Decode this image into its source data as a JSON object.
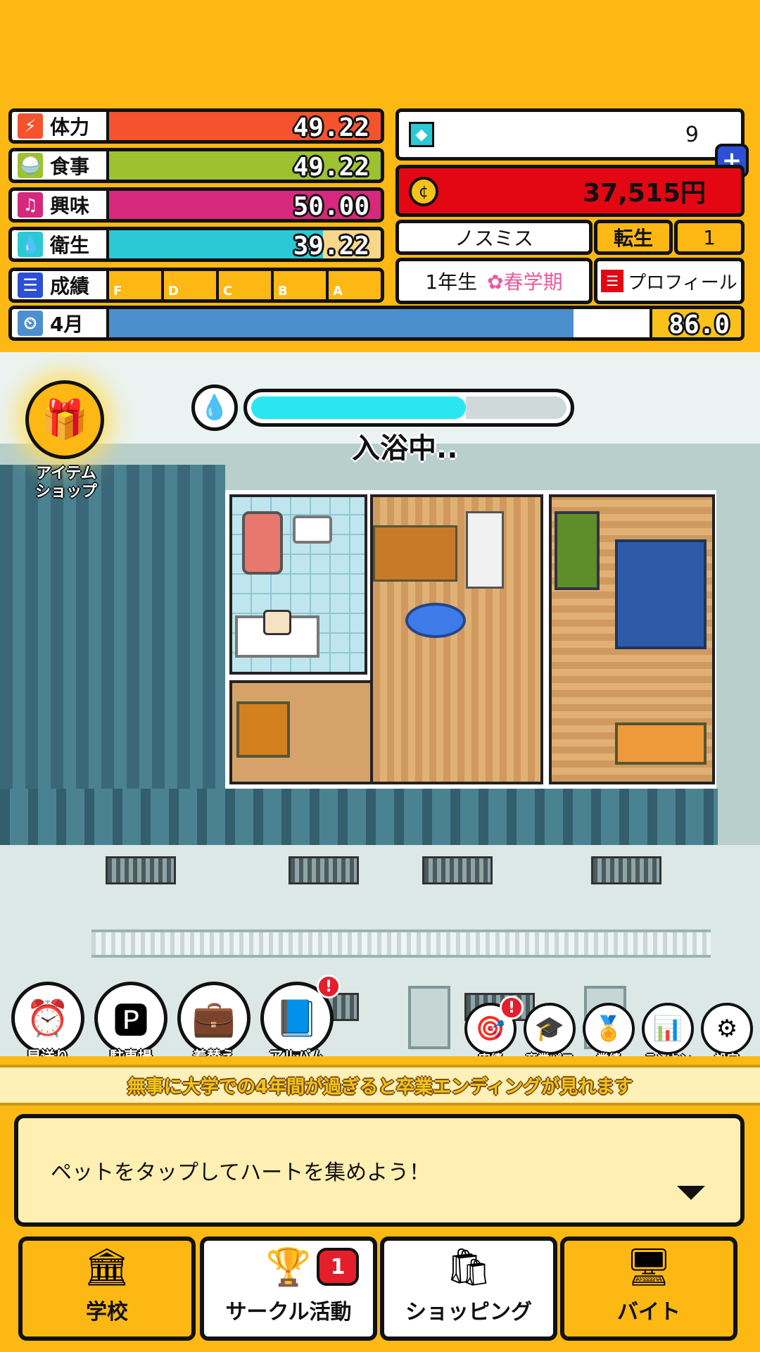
{
  "stats": [
    {
      "label": "体力",
      "value": "49.22",
      "color": "#F4532E",
      "icon": "lightning-icon",
      "fraction": 1.0
    },
    {
      "label": "食事",
      "value": "49.22",
      "color": "#9CC230",
      "icon": "food-icon",
      "fraction": 1.0
    },
    {
      "label": "興味",
      "value": "50.00",
      "color": "#D6287C",
      "icon": "music-note-icon",
      "fraction": 1.0
    },
    {
      "label": "衛生",
      "value": "39.22",
      "color": "#2BC9D6",
      "icon": "droplet-icon",
      "fraction": 0.79
    }
  ],
  "grades": {
    "label": "成績",
    "items": [
      "F",
      "D",
      "C",
      "B",
      "A"
    ]
  },
  "month": {
    "label": "4月",
    "value": "86.0",
    "fraction": 0.86,
    "color": "#4C8FCE"
  },
  "gems": {
    "value": "9"
  },
  "money": {
    "value": "37,515円"
  },
  "player": {
    "name": "ノスミス",
    "rebirth_label": "転生",
    "rebirth_count": "1",
    "year": "1年生",
    "term": "春学期",
    "profile_label": "プロフィール"
  },
  "scene": {
    "status": "入浴中..",
    "bath_progress": 0.68,
    "shop_label_1": "アイテム",
    "shop_label_2": "ショップ"
  },
  "quick_buttons": [
    {
      "label": "早送り",
      "icon": "alarm-clock-icon",
      "glyph": "⏰"
    },
    {
      "label": "駐車場",
      "icon": "parking-icon",
      "glyph": "🅿"
    },
    {
      "label": "着替え",
      "icon": "suitcase-icon",
      "glyph": "💼"
    },
    {
      "label": "アルバム",
      "icon": "album-icon",
      "glyph": "📘",
      "alert": "!"
    }
  ],
  "small_buttons": [
    {
      "label": "実績",
      "icon": "target-icon",
      "glyph": "🎯",
      "alert": "!"
    },
    {
      "label": "卒業パフ",
      "icon": "graduation-cap-icon",
      "glyph": "🎓"
    },
    {
      "label": "業績",
      "icon": "award-icon",
      "glyph": "🏅"
    },
    {
      "label": "ランキン",
      "icon": "ranking-icon",
      "glyph": "📊"
    },
    {
      "label": "設定",
      "icon": "gear-icon",
      "glyph": "⚙"
    }
  ],
  "ticker": "無事に大学での4年間が過ぎると卒業エンディングが見れます",
  "message": "ペットをタップしてハートを集めよう！",
  "nav": [
    {
      "label": "学校",
      "icon": "school-icon",
      "glyph": "🏛"
    },
    {
      "label": "サークル活動",
      "icon": "trophy-icon",
      "glyph": "🏆",
      "badge": "1"
    },
    {
      "label": "ショッピング",
      "icon": "shopping-bag-icon",
      "glyph": "🛍"
    },
    {
      "label": "バイト",
      "icon": "register-icon",
      "glyph": "🖥"
    }
  ],
  "colors": {
    "background": "#FDB813",
    "money_bg": "#E30613",
    "term": "#E85AA0"
  }
}
